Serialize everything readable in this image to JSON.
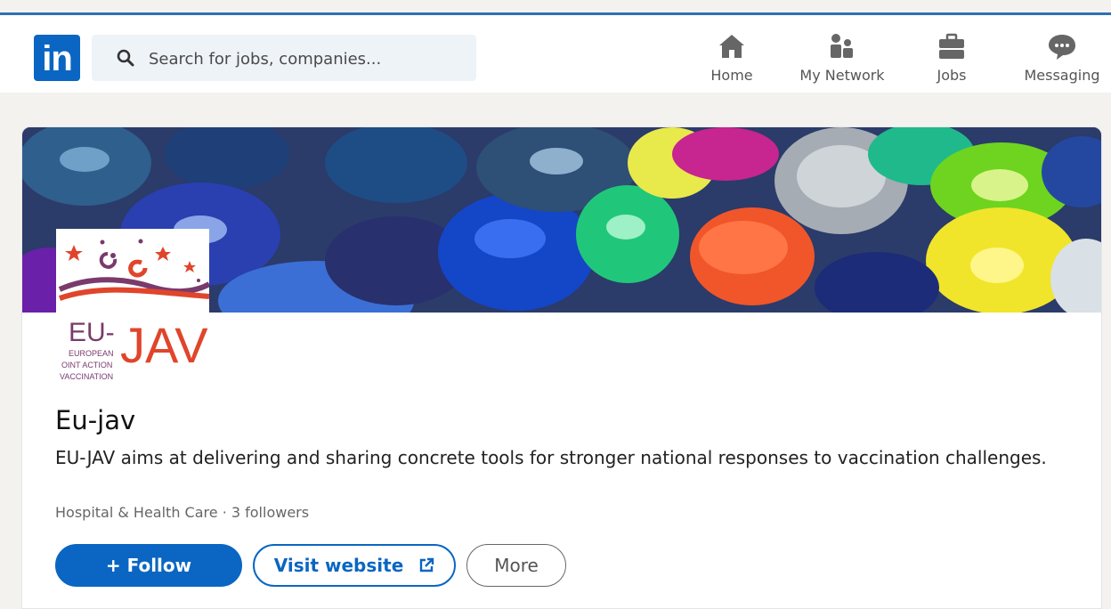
{
  "header": {
    "logo_text": "in",
    "search_placeholder": "Search for jobs, companies...",
    "nav": [
      {
        "label": "Home",
        "icon": "home-icon"
      },
      {
        "label": "My Network",
        "icon": "network-icon"
      },
      {
        "label": "Jobs",
        "icon": "briefcase-icon"
      },
      {
        "label": "Messaging",
        "icon": "messaging-icon"
      }
    ]
  },
  "company": {
    "name": "Eu-jav",
    "description": "EU-JAV aims at delivering and sharing concrete tools for stronger national responses to vaccination challenges.",
    "meta": "Hospital & Health Care · 3 followers",
    "logo_text": [
      "EU-",
      "JAV",
      "EUROPEAN",
      "OINT ACTION",
      "VACCINATION"
    ]
  },
  "actions": {
    "follow_label": "+ Follow",
    "visit_label": "Visit website",
    "more_label": "More"
  },
  "colors": {
    "brand": "#0a66c2",
    "accent_red": "#e0452b",
    "logo_purple": "#6b3e6e"
  }
}
